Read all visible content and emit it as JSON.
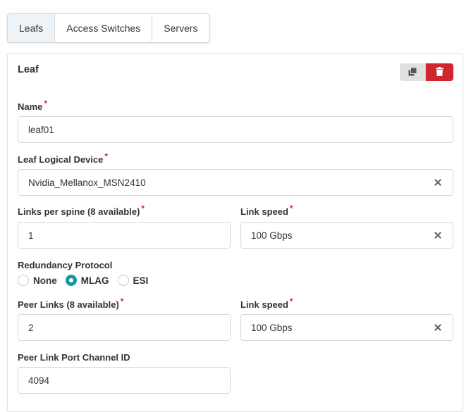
{
  "tabs": [
    {
      "label": "Leafs",
      "active": true
    },
    {
      "label": "Access Switches",
      "active": false
    },
    {
      "label": "Servers",
      "active": false
    }
  ],
  "card": {
    "title": "Leaf",
    "actions": {
      "copy_icon": "copy-icon",
      "delete_icon": "trash-icon",
      "delete_color": "#d0262d"
    }
  },
  "form": {
    "required_mark": "*",
    "name": {
      "label": "Name",
      "value": "leaf01"
    },
    "logical_device": {
      "label": "Leaf Logical Device",
      "value": "Nvidia_Mellanox_MSN2410"
    },
    "links_per_spine": {
      "label": "Links per spine (8 available)",
      "value": "1"
    },
    "link_speed": {
      "label": "Link speed",
      "value": "100 Gbps"
    },
    "redundancy": {
      "label": "Redundancy Protocol",
      "options": [
        "None",
        "MLAG",
        "ESI"
      ],
      "selected": "MLAG",
      "accent": "#17969d"
    },
    "peer_links": {
      "label": "Peer Links (8 available)",
      "value": "2"
    },
    "peer_link_speed": {
      "label": "Link speed",
      "value": "100 Gbps"
    },
    "port_channel_id": {
      "label": "Peer Link Port Channel ID",
      "value": "4094"
    }
  }
}
